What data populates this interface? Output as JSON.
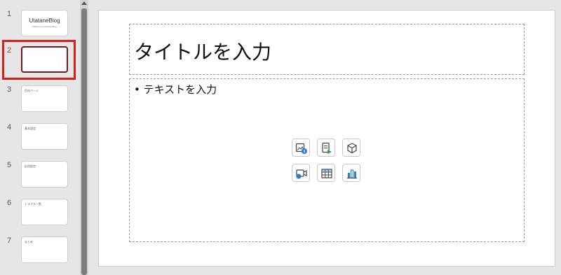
{
  "thumbnails": [
    {
      "num": "1",
      "center_title": "UtataneBlog",
      "center_sub": "Welcome to Utatane Blog",
      "corner": ""
    },
    {
      "num": "2",
      "center_title": "",
      "center_sub": "",
      "corner": ""
    },
    {
      "num": "3",
      "center_title": "",
      "center_sub": "",
      "corner": "目次ページ"
    },
    {
      "num": "4",
      "center_title": "",
      "center_sub": "",
      "corner": "基本設定"
    },
    {
      "num": "5",
      "center_title": "",
      "center_sub": "",
      "corner": "応用設定"
    },
    {
      "num": "6",
      "center_title": "",
      "center_sub": "",
      "corner": "トラブル一覧"
    },
    {
      "num": "7",
      "center_title": "",
      "center_sub": "",
      "corner": "まとめ"
    }
  ],
  "selected_slide": "2",
  "slide": {
    "title_placeholder": "タイトルを入力",
    "body_placeholder": "• テキストを入力"
  },
  "insert_icons": [
    "insert-picture-icon",
    "insert-icon-icon",
    "insert-3d-model-icon",
    "insert-video-icon",
    "insert-table-icon",
    "insert-chart-icon"
  ],
  "colors": {
    "selection": "#e01b1b",
    "selected_border": "#6d1c22",
    "icon_blue": "#2b7cd3",
    "icon_green": "#2e9e4f"
  }
}
